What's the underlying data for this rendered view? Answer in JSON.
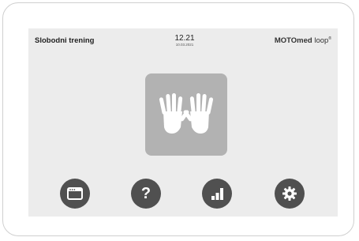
{
  "header": {
    "title": "Slobodni trening",
    "time": "12.21",
    "date": "10.03.2021",
    "brand_bold": "MOTOmed",
    "brand_rest": " loop",
    "brand_mark": "®"
  },
  "main": {
    "center_icon": "hands-icon"
  },
  "toolbar": {
    "buttons": [
      {
        "icon": "window-icon"
      },
      {
        "icon": "question-mark-icon",
        "glyph": "?"
      },
      {
        "icon": "bar-chart-icon"
      },
      {
        "icon": "gear-icon"
      }
    ]
  },
  "colors": {
    "screen_background": "#ececec",
    "button": "#505050",
    "tile": "#b2b2b2",
    "icon": "#ffffff"
  }
}
